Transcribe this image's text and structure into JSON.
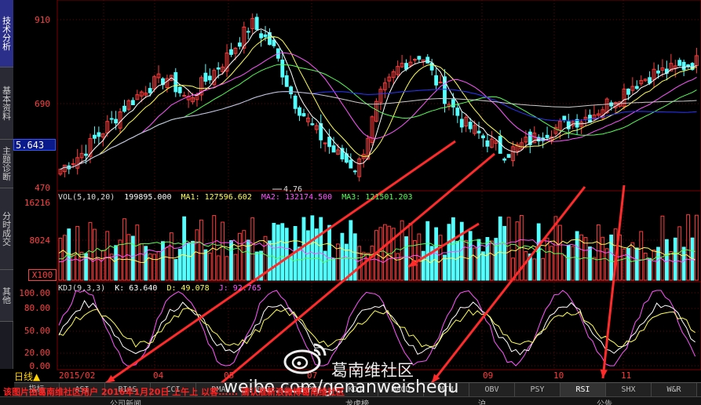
{
  "side_tabs": [
    {
      "label": "技术分析",
      "active": true
    },
    {
      "label": "基本资料",
      "active": false
    },
    {
      "label": "主题诊断",
      "active": false
    },
    {
      "label": "分时成交",
      "active": false
    },
    {
      "label": "其他",
      "active": false
    }
  ],
  "price_panel": {
    "current_price": "5.643",
    "y_ticks": [
      "910",
      "690",
      "470"
    ],
    "low_label": "4.76"
  },
  "volume_panel": {
    "indicator": "VOL(5,10,20)",
    "vol_value": "199895.000",
    "ma1": "MA1: 127596.602",
    "ma2": "MA2: 132174.500",
    "ma3": "MA3: 121501.203",
    "y_ticks": [
      "16216",
      "8024",
      "X100"
    ]
  },
  "kdj_panel": {
    "indicator": "KDJ(9,3,3)",
    "k": "K: 63.640",
    "d": "D: 49.078",
    "j": "J: 92.765",
    "y_ticks": [
      "100.00",
      "80.00",
      "50.00",
      "20.00",
      "0.00"
    ]
  },
  "x_axis": {
    "period": "日线",
    "labels": [
      "2015/02",
      "04",
      "05",
      "07",
      "09",
      "10",
      "11"
    ]
  },
  "bottom_tabs": [
    "指标",
    "ASI",
    "BIAS",
    "CCI",
    "DMA",
    "DMI",
    "EXPMA",
    "KDJ",
    "MACD",
    "MTM",
    "OBV",
    "PSY",
    "RSI",
    "SHX",
    "W&R"
  ],
  "bottom_bar": {
    "left": "公司新闻",
    "middle": "龙虎榜",
    "center": "沪",
    "right": "公告"
  },
  "caption": "该图片由葛南维社区用户 2016年1月20日 上午上 以客...... 请认准新浪微博葛南维社区",
  "watermark": {
    "name": "葛南维社区",
    "url": "weibo.com/genanweishequ"
  },
  "colors": {
    "up": "#ff3b3b",
    "down": "#54ffff",
    "ma5": "#ffffff",
    "ma10": "#ffff55",
    "ma20": "#ff55ff",
    "ma30": "#55ff55",
    "ma60": "#2a36ff",
    "ma120": "#cccccc",
    "arrow": "#ff2a2a"
  },
  "chart_data": {
    "type": "candlestick",
    "title": "",
    "xlabel": "",
    "ylabel": "",
    "ylim": [
      470,
      960
    ],
    "x": [
      "2015/02",
      "04",
      "05",
      "07",
      "09",
      "10",
      "11"
    ],
    "close": [
      520,
      560,
      620,
      680,
      730,
      760,
      700,
      760,
      820,
      900,
      840,
      700,
      620,
      560,
      520,
      700,
      790,
      820,
      720,
      640,
      600,
      560,
      590,
      620,
      640,
      660,
      700,
      740,
      770,
      780,
      800
    ],
    "volume_max": 16216,
    "kdj_range": [
      0,
      100
    ]
  }
}
